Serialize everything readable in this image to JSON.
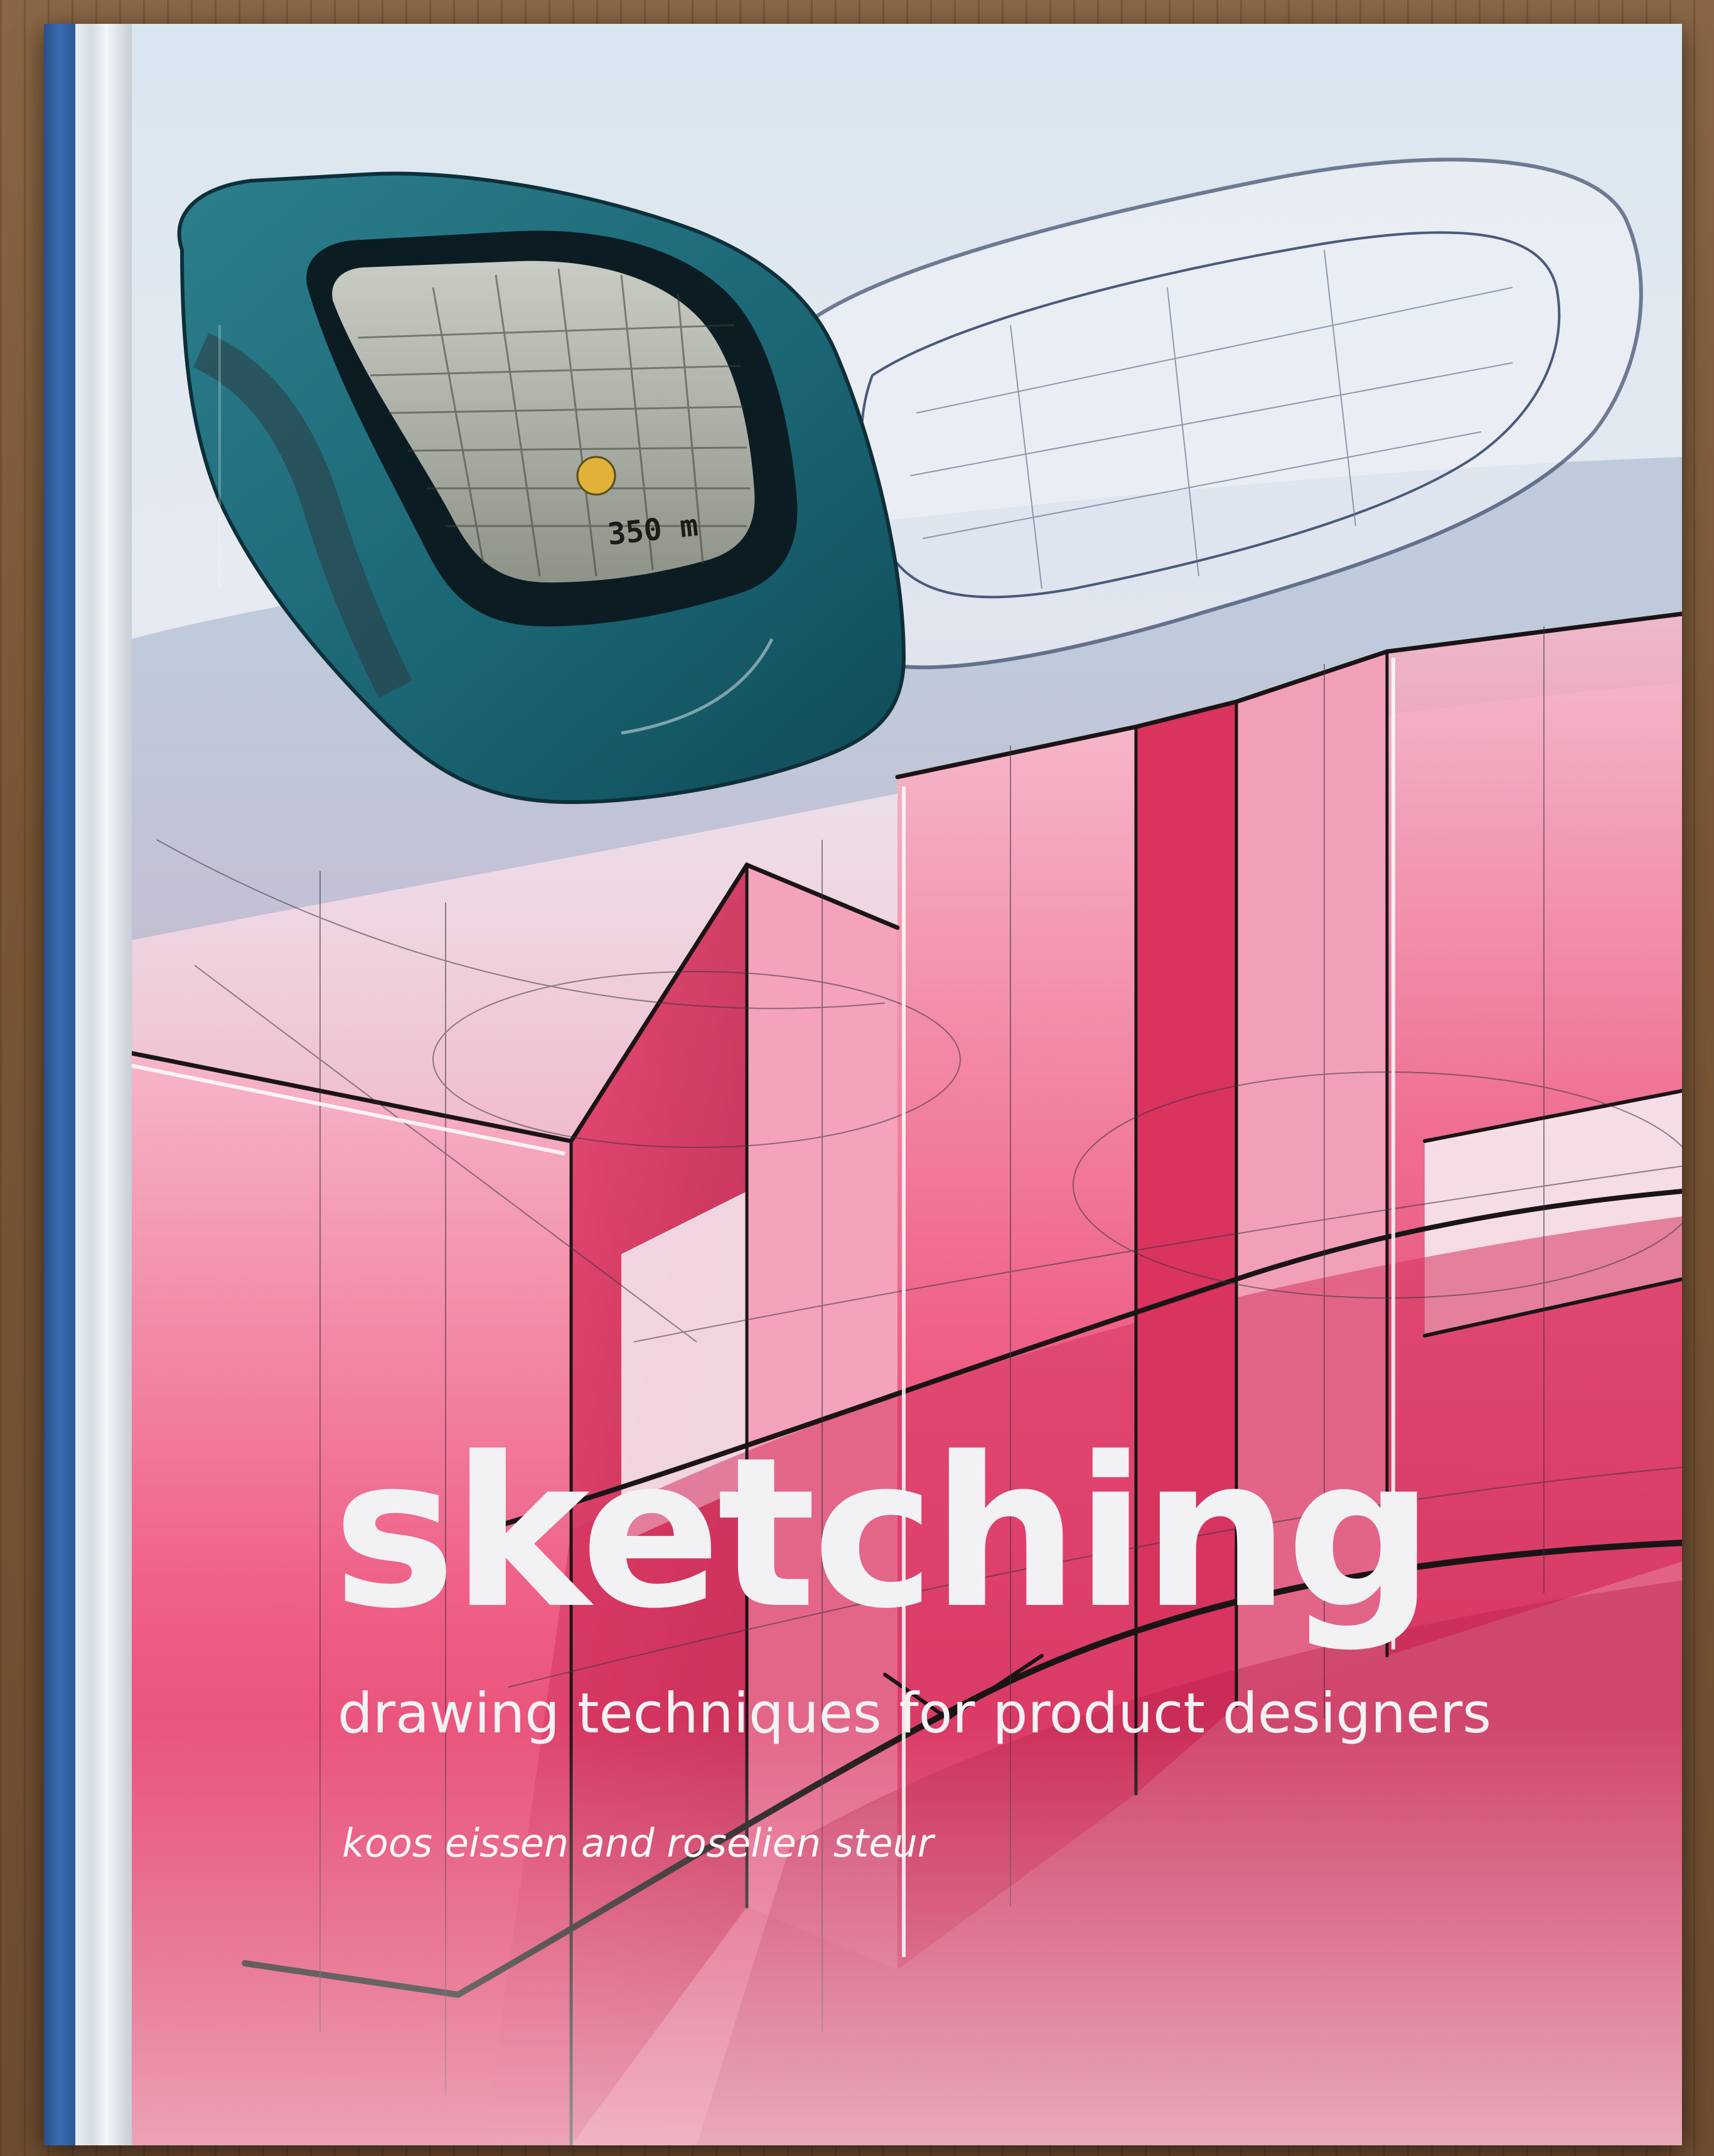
{
  "book": {
    "title": "sketching",
    "subtitle": "drawing techniques for product designers",
    "authors": "koos eissen and roselien steur",
    "device_screen_text": "350 m"
  },
  "colors": {
    "sky": "#dfe6ee",
    "pink": "#e64a74",
    "deep_red": "#c8284f",
    "teal": "#1d6f7e",
    "spine_blue": "#2f5f9f",
    "text": "#f2f2f4"
  }
}
